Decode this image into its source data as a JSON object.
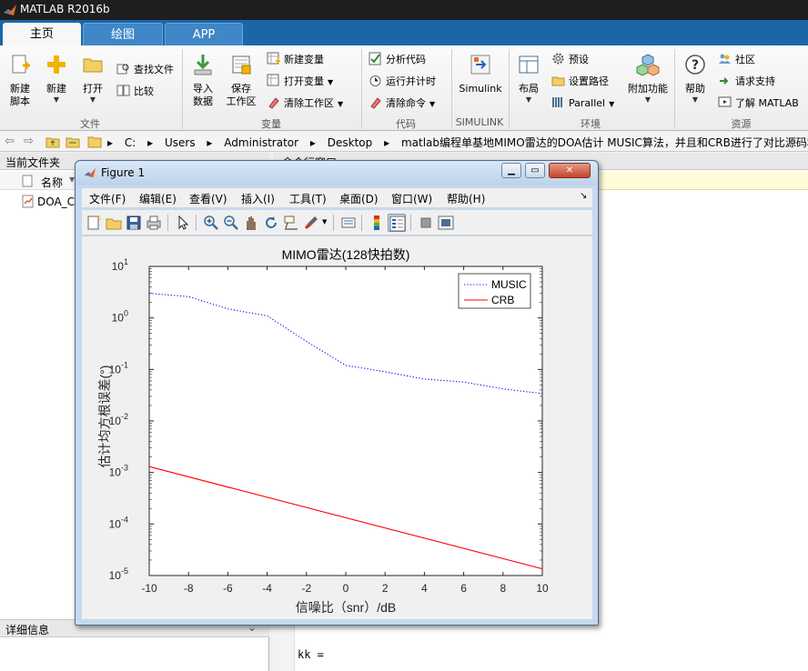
{
  "window": {
    "title": "MATLAB R2016b"
  },
  "ribbon_tabs": [
    "主页",
    "绘图",
    "APP"
  ],
  "ribbon": {
    "file_group": {
      "label": "文件",
      "new_script": "新建\n脚本",
      "new": "新建",
      "open": "打开",
      "find_files": "查找文件",
      "compare": "比较"
    },
    "variable_group": {
      "label": "变量",
      "import_data": "导入\n数据",
      "save_workspace": "保存\n工作区",
      "new_variable": "新建变量",
      "open_variable": "打开变量",
      "clear_workspace": "清除工作区"
    },
    "code_group": {
      "label": "代码",
      "analyze_code": "分析代码",
      "run_and_time": "运行并计时",
      "clear_commands": "清除命令"
    },
    "simulink_group": {
      "label": "SIMULINK",
      "simulink": "Simulink"
    },
    "environment_group": {
      "label": "环境",
      "layout": "布局",
      "preferences": "预设",
      "set_path": "设置路径",
      "parallel": "Parallel",
      "addons": "附加功能"
    },
    "resources_group": {
      "label": "资源",
      "help": "帮助",
      "community": "社区",
      "request_support": "请求支持",
      "learn_matlab": "了解 MATLAB"
    }
  },
  "address_bar": {
    "path": [
      "C:",
      "Users",
      "Administrator",
      "Desktop",
      "matlab编程单基地MIMO雷达的DOA估计 MUSIC算法，并且和CRB进行了对比源码程序"
    ]
  },
  "current_folder": {
    "title": "当前文件夹",
    "column_name": "名称",
    "files": [
      "DOA_C"
    ]
  },
  "details_panel": {
    "title": "详细信息"
  },
  "command_window": {
    "title": "命令行窗口",
    "last_line": "kk ="
  },
  "figure": {
    "title": "Figure 1",
    "menu": [
      "文件(F)",
      "编辑(E)",
      "查看(V)",
      "插入(I)",
      "工具(T)",
      "桌面(D)",
      "窗口(W)",
      "帮助(H)"
    ],
    "toolbar_icons": [
      "new-figure-icon",
      "open-file-icon",
      "save-icon",
      "print-icon",
      "pointer-icon",
      "zoom-in-icon",
      "zoom-out-icon",
      "pan-icon",
      "rotate-3d-icon",
      "data-cursor-icon",
      "brush-icon",
      "link-plot-icon",
      "colorbar-icon",
      "legend-icon",
      "hide-plot-tools-icon",
      "show-plot-tools-icon"
    ]
  },
  "chart_data": {
    "type": "line",
    "title": "MIMO雷达(128快拍数)",
    "xlabel": "信噪比（snr）/dB",
    "ylabel": "估计均方根误差(°)",
    "xlim": [
      -10,
      10
    ],
    "ylim": [
      1e-05,
      10
    ],
    "yscale": "log",
    "xticks": [
      "-10",
      "-8",
      "-6",
      "-4",
      "-2",
      "0",
      "2",
      "4",
      "6",
      "8",
      "10"
    ],
    "yticks_exponent": [
      "1",
      "0",
      "-1",
      "-2",
      "-3",
      "-4",
      "-5"
    ],
    "ytick_base": "10",
    "legend_position": "top-right",
    "grid": false,
    "series": [
      {
        "name": "MUSIC",
        "style": "dotted",
        "color": "#0000ff",
        "x": [
          -10,
          -8,
          -6,
          -4,
          -2,
          0,
          2,
          4,
          6,
          8,
          10
        ],
        "y": [
          3.0,
          2.6,
          1.5,
          1.1,
          0.35,
          0.12,
          0.09,
          0.065,
          0.057,
          0.042,
          0.034
        ]
      },
      {
        "name": "CRB",
        "style": "solid",
        "color": "#ff0000",
        "x": [
          -10,
          10
        ],
        "y": [
          0.0013,
          1.35e-05
        ]
      }
    ]
  }
}
